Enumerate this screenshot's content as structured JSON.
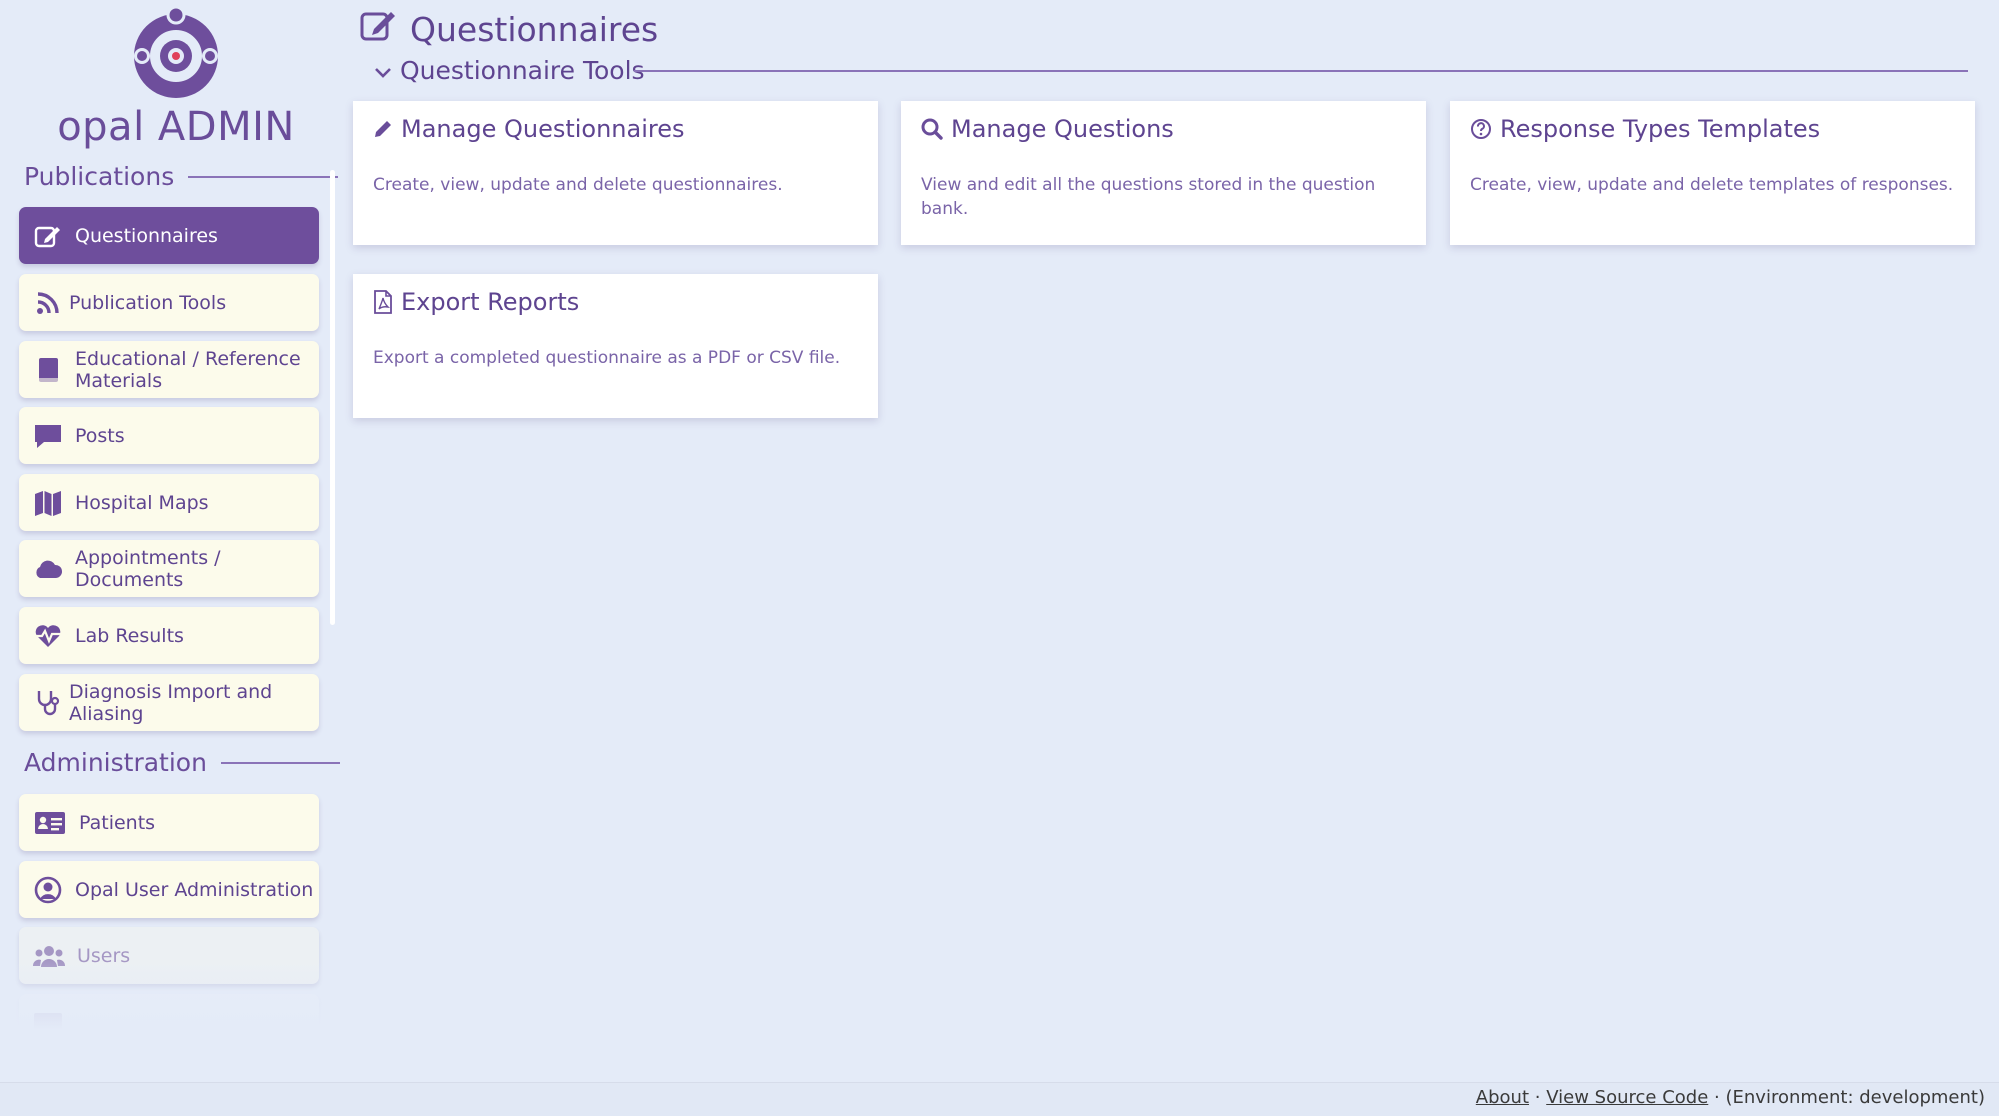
{
  "logo": {
    "prefix": "opal",
    "suffix": "ADMIN"
  },
  "colors": {
    "accent": "#6e4e9c",
    "nav_bg": "#fcfbeb",
    "page_bg": "#e4ebf8",
    "heart": "#e0415a"
  },
  "sidebar": {
    "publications_heading": "Publications",
    "administration_heading": "Administration",
    "publications": [
      {
        "label": "Questionnaires",
        "icon": "edit-icon"
      },
      {
        "label": "Publication Tools",
        "icon": "rss-icon"
      },
      {
        "label": "Educational / Reference Materials",
        "icon": "book-icon"
      },
      {
        "label": "Posts",
        "icon": "comment-icon"
      },
      {
        "label": "Hospital Maps",
        "icon": "map-icon"
      },
      {
        "label": "Appointments / Documents",
        "icon": "cloud-icon"
      },
      {
        "label": "Lab Results",
        "icon": "heartbeat-icon"
      },
      {
        "label": "Diagnosis Import and Aliasing",
        "icon": "stethoscope-icon"
      }
    ],
    "administration": [
      {
        "label": "Patients",
        "icon": "id-card-icon"
      },
      {
        "label": "Opal User Administration",
        "icon": "user-circle-icon"
      },
      {
        "label": "Users",
        "icon": "users-icon"
      }
    ]
  },
  "main": {
    "title": "Questionnaires",
    "section": "Questionnaire Tools",
    "cards": [
      {
        "title": "Manage Questionnaires",
        "description": "Create, view, update and delete questionnaires.",
        "icon": "pencil-icon"
      },
      {
        "title": "Manage Questions",
        "description": "View and edit all the questions stored in the question bank.",
        "icon": "search-icon"
      },
      {
        "title": "Response Types Templates",
        "description": "Create, view, update and delete templates of responses.",
        "icon": "question-circle-icon"
      },
      {
        "title": "Export Reports",
        "description": "Export a completed questionnaire as a PDF or CSV file.",
        "icon": "file-pdf-icon"
      }
    ]
  },
  "footer": {
    "about": "About",
    "separator": "·",
    "source": "View Source Code",
    "environment": "(Environment: development)"
  }
}
